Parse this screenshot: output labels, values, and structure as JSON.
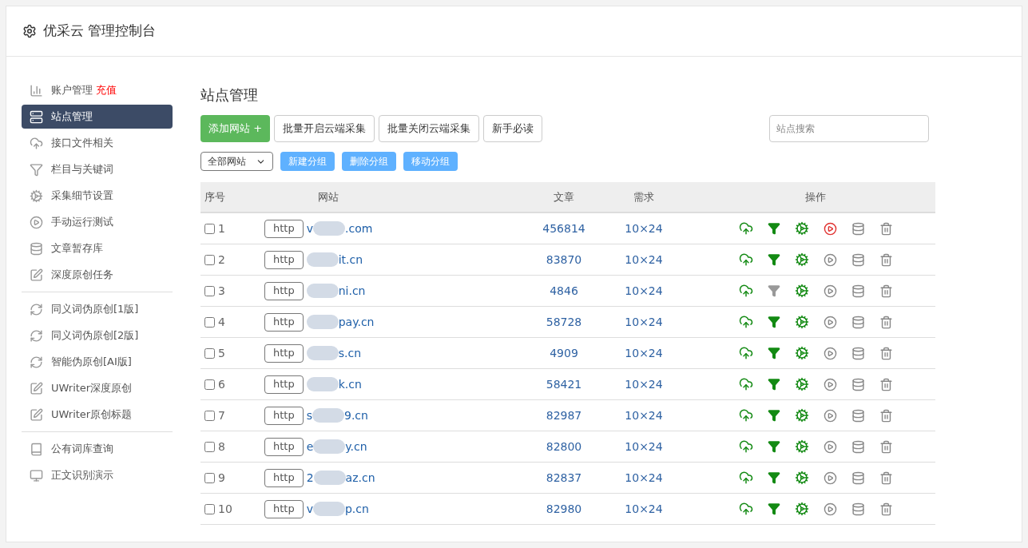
{
  "header": {
    "title": "优采云 管理控制台"
  },
  "sidebar": {
    "groups": [
      {
        "items": [
          {
            "label": "账户管理",
            "badge": "充值",
            "selected": false
          },
          {
            "label": "站点管理",
            "selected": true
          },
          {
            "label": "接口文件相关",
            "selected": false
          },
          {
            "label": "栏目与关键词",
            "selected": false
          },
          {
            "label": "采集细节设置",
            "selected": false
          },
          {
            "label": "手动运行测试",
            "selected": false
          },
          {
            "label": "文章暂存库",
            "selected": false
          },
          {
            "label": "深度原创任务",
            "selected": false
          }
        ]
      },
      {
        "items": [
          {
            "label": "同义词伪原创[1版]",
            "selected": false
          },
          {
            "label": "同义词伪原创[2版]",
            "selected": false
          },
          {
            "label": "智能伪原创[AI版]",
            "selected": false
          },
          {
            "label": "UWriter深度原创",
            "selected": false
          },
          {
            "label": "UWriter原创标题",
            "selected": false
          }
        ]
      },
      {
        "items": [
          {
            "label": "公有词库查询",
            "selected": false
          },
          {
            "label": "正文识别演示",
            "selected": false
          }
        ]
      }
    ]
  },
  "main": {
    "title": "站点管理",
    "buttons": [
      {
        "label": "添加网站 +",
        "kind": "primary"
      },
      {
        "label": "批量开启云端采集",
        "kind": "default"
      },
      {
        "label": "批量关闭云端采集",
        "kind": "default"
      },
      {
        "label": "新手必读",
        "kind": "default"
      }
    ],
    "search": {
      "placeholder": "站点搜索"
    },
    "group_select": {
      "value": "全部网站"
    },
    "group_buttons": [
      "新建分组",
      "删除分组",
      "移动分组"
    ],
    "table": {
      "columns": [
        "序号",
        "网站",
        "文章",
        "需求",
        "操作"
      ],
      "rows": [
        {
          "checked": false,
          "index": "1",
          "scheme": "http",
          "url_start": "v",
          "url_end": ".com",
          "articles": "456814",
          "demand": "10×24",
          "filter_on": true,
          "running": true
        },
        {
          "checked": false,
          "index": "2",
          "scheme": "http",
          "url_start": "",
          "url_end": "it.cn",
          "articles": "83870",
          "demand": "10×24",
          "filter_on": true,
          "running": false
        },
        {
          "checked": false,
          "index": "3",
          "scheme": "http",
          "url_start": "",
          "url_end": "ni.cn",
          "articles": "4846",
          "demand": "10×24",
          "filter_on": false,
          "running": false
        },
        {
          "checked": false,
          "index": "4",
          "scheme": "http",
          "url_start": "",
          "url_end": "pay.cn",
          "articles": "58728",
          "demand": "10×24",
          "filter_on": true,
          "running": false
        },
        {
          "checked": false,
          "index": "5",
          "scheme": "http",
          "url_start": "",
          "url_end": "s.cn",
          "articles": "4909",
          "demand": "10×24",
          "filter_on": true,
          "running": false
        },
        {
          "checked": false,
          "index": "6",
          "scheme": "http",
          "url_start": "",
          "url_end": "k.cn",
          "articles": "58421",
          "demand": "10×24",
          "filter_on": true,
          "running": false
        },
        {
          "checked": false,
          "index": "7",
          "scheme": "http",
          "url_start": "s",
          "url_end": "9.cn",
          "articles": "82987",
          "demand": "10×24",
          "filter_on": true,
          "running": false
        },
        {
          "checked": false,
          "index": "8",
          "scheme": "http",
          "url_start": "e",
          "url_end": "y.cn",
          "articles": "82800",
          "demand": "10×24",
          "filter_on": true,
          "running": false
        },
        {
          "checked": false,
          "index": "9",
          "scheme": "http",
          "url_start": "2",
          "url_end": "az.cn",
          "articles": "82837",
          "demand": "10×24",
          "filter_on": true,
          "running": false
        },
        {
          "checked": false,
          "index": "10",
          "scheme": "http",
          "url_start": "v",
          "url_end": "p.cn",
          "articles": "82980",
          "demand": "10×24",
          "filter_on": true,
          "running": false
        }
      ]
    }
  }
}
